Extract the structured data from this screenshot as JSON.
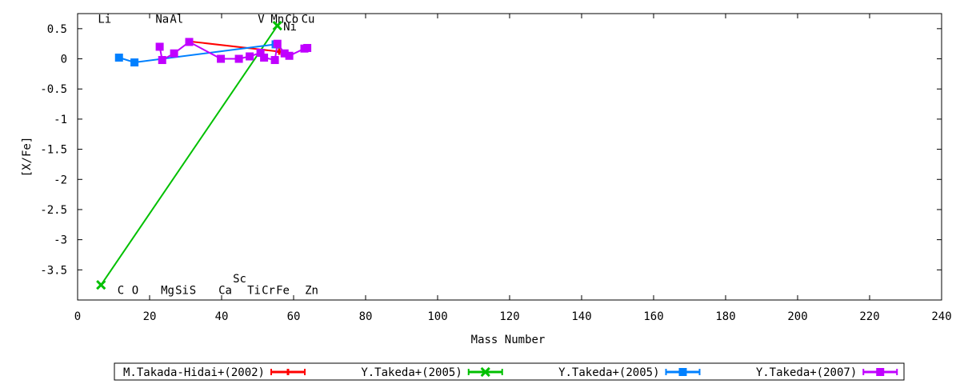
{
  "chart_data": {
    "type": "line",
    "xlabel": "Mass Number",
    "ylabel": "[X/Fe]",
    "xlim": [
      0,
      240
    ],
    "ylim": [
      -4,
      0.75
    ],
    "xticks": [
      0,
      20,
      40,
      60,
      80,
      100,
      120,
      140,
      160,
      180,
      200,
      220,
      240
    ],
    "yticks": [
      0.5,
      0,
      -0.5,
      -1,
      -1.5,
      -2,
      -2.5,
      -3,
      -3.5
    ],
    "ytick_labels": [
      "0.5",
      "0",
      "-0.5",
      "-1",
      "-1.5",
      "-2",
      "-2.5",
      "-3",
      "-3.5"
    ],
    "grid": false,
    "legend_position": "bottom",
    "series": [
      {
        "name": "M.Takada-Hidai+(2002)",
        "color": "#ff0000",
        "marker": "plus",
        "points": [
          [
            31.0,
            0.29
          ],
          [
            56.0,
            0.12
          ]
        ]
      },
      {
        "name": "Y.Takeda+(2005)",
        "color": "#00c000",
        "marker": "cross",
        "points": [
          [
            6.5,
            -3.75
          ],
          [
            55.5,
            0.55
          ]
        ]
      },
      {
        "name": "Y.Takeda+(2005)",
        "color": "#0080ff",
        "marker": "square",
        "points": [
          [
            11.5,
            0.02
          ],
          [
            15.8,
            -0.06
          ],
          [
            55.0,
            0.24
          ]
        ]
      },
      {
        "name": "Y.Takeda+(2007)",
        "color": "#c000ff",
        "marker": "square",
        "points": [
          [
            22.8,
            0.2
          ],
          [
            23.5,
            -0.02
          ],
          [
            26.8,
            0.09
          ],
          [
            31.0,
            0.28
          ],
          [
            39.8,
            0.0
          ],
          [
            44.8,
            0.0
          ],
          [
            47.8,
            0.04
          ],
          [
            50.8,
            0.1
          ],
          [
            51.8,
            0.02
          ],
          [
            54.8,
            -0.02
          ],
          [
            55.5,
            0.25
          ],
          [
            57.5,
            0.09
          ],
          [
            58.8,
            0.05
          ],
          [
            63.0,
            0.17
          ],
          [
            63.8,
            0.18
          ]
        ]
      }
    ],
    "element_labels": [
      {
        "text": "Li",
        "x": 7.5,
        "y": 0.6
      },
      {
        "text": "Na",
        "x": 23.5,
        "y": 0.6
      },
      {
        "text": "Al",
        "x": 27.5,
        "y": 0.6
      },
      {
        "text": "V",
        "x": 51.0,
        "y": 0.6
      },
      {
        "text": "Mn",
        "x": 55.5,
        "y": 0.6
      },
      {
        "text": "Co",
        "x": 59.5,
        "y": 0.6
      },
      {
        "text": "Cu",
        "x": 64.0,
        "y": 0.6
      },
      {
        "text": "Ni",
        "x": 59.0,
        "y": 0.47
      },
      {
        "text": "C",
        "x": 12.0,
        "y": -3.9
      },
      {
        "text": "O",
        "x": 16.0,
        "y": -3.9
      },
      {
        "text": "Mg",
        "x": 25.0,
        "y": -3.9
      },
      {
        "text": "Si",
        "x": 29.0,
        "y": -3.9
      },
      {
        "text": "S",
        "x": 32.0,
        "y": -3.9
      },
      {
        "text": "Ca",
        "x": 41.0,
        "y": -3.9
      },
      {
        "text": "Sc",
        "x": 45.0,
        "y": -3.71
      },
      {
        "text": "Ti",
        "x": 49.0,
        "y": -3.9
      },
      {
        "text": "Cr",
        "x": 53.0,
        "y": -3.9
      },
      {
        "text": "Fe",
        "x": 57.0,
        "y": -3.9
      },
      {
        "text": "Zn",
        "x": 65.0,
        "y": -3.9
      }
    ]
  }
}
